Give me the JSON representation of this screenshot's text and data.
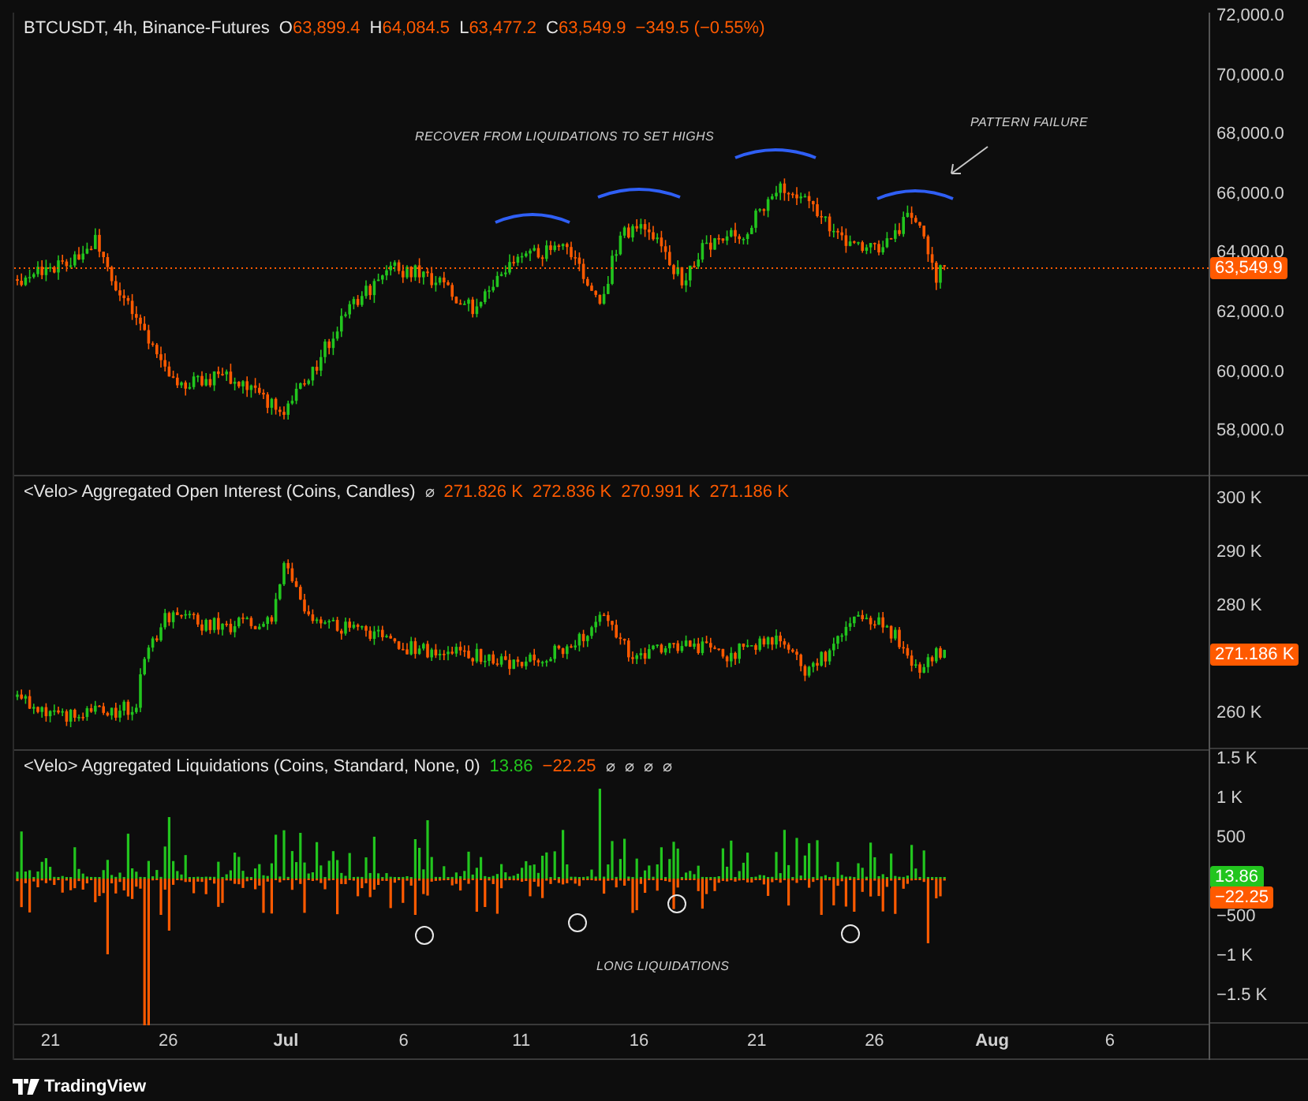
{
  "price_pane": {
    "legend": {
      "title": "BTCUSDT, 4h, Binance-Futures",
      "ohlc": [
        {
          "key": "O",
          "value": "63,899.4"
        },
        {
          "key": "H",
          "value": "64,084.5"
        },
        {
          "key": "L",
          "value": "63,477.2"
        },
        {
          "key": "C",
          "value": "63,549.9"
        }
      ],
      "change": "−349.5 (−0.55%)"
    },
    "axis": [
      "72,000.0",
      "70,000.0",
      "68,000.0",
      "66,000.0",
      "64,000.0",
      "62,000.0",
      "60,000.0",
      "58,000.0"
    ],
    "badges": [
      {
        "text": "63,549.9",
        "color": "#ff5a00"
      }
    ],
    "annotations": [
      "RECOVER FROM LIQUIDATIONS TO SET HIGHS",
      "PATTERN FAILURE"
    ]
  },
  "open_interest_pane": {
    "legend": {
      "title": "<Velo> Aggregated Open Interest (Coins, Candles)",
      "icon_text": "⌀",
      "values": [
        "271.826 K",
        "272.836 K",
        "270.991 K",
        "271.186 K"
      ]
    },
    "axis": [
      "300 K",
      "290 K",
      "280 K",
      "260 K"
    ],
    "badges": [
      {
        "text": "271.186 K",
        "color": "#ff5a00"
      }
    ]
  },
  "liquidations_pane": {
    "legend": {
      "title": "<Velo> Aggregated Liquidations (Coins, Standard, None, 0)",
      "values": [
        {
          "text": "13.86",
          "color": "#22c51e"
        },
        {
          "text": "−22.25",
          "color": "#ff5a00"
        }
      ],
      "icons": [
        "⌀",
        "⌀",
        "⌀",
        "⌀"
      ]
    },
    "axis": [
      "1.5 K",
      "1 K",
      "500",
      "−500",
      "−1 K",
      "−1.5 K"
    ],
    "badges": [
      {
        "text": "13.86",
        "color": "#22c51e"
      },
      {
        "text": "−22.25",
        "color": "#ff5a00"
      }
    ],
    "annotations": [
      "LONG LIQUIDATIONS"
    ]
  },
  "time_axis": [
    "21",
    "26",
    "Jul",
    "6",
    "11",
    "16",
    "21",
    "26",
    "Aug",
    "6"
  ],
  "footer": {
    "brand": "TradingView"
  }
}
